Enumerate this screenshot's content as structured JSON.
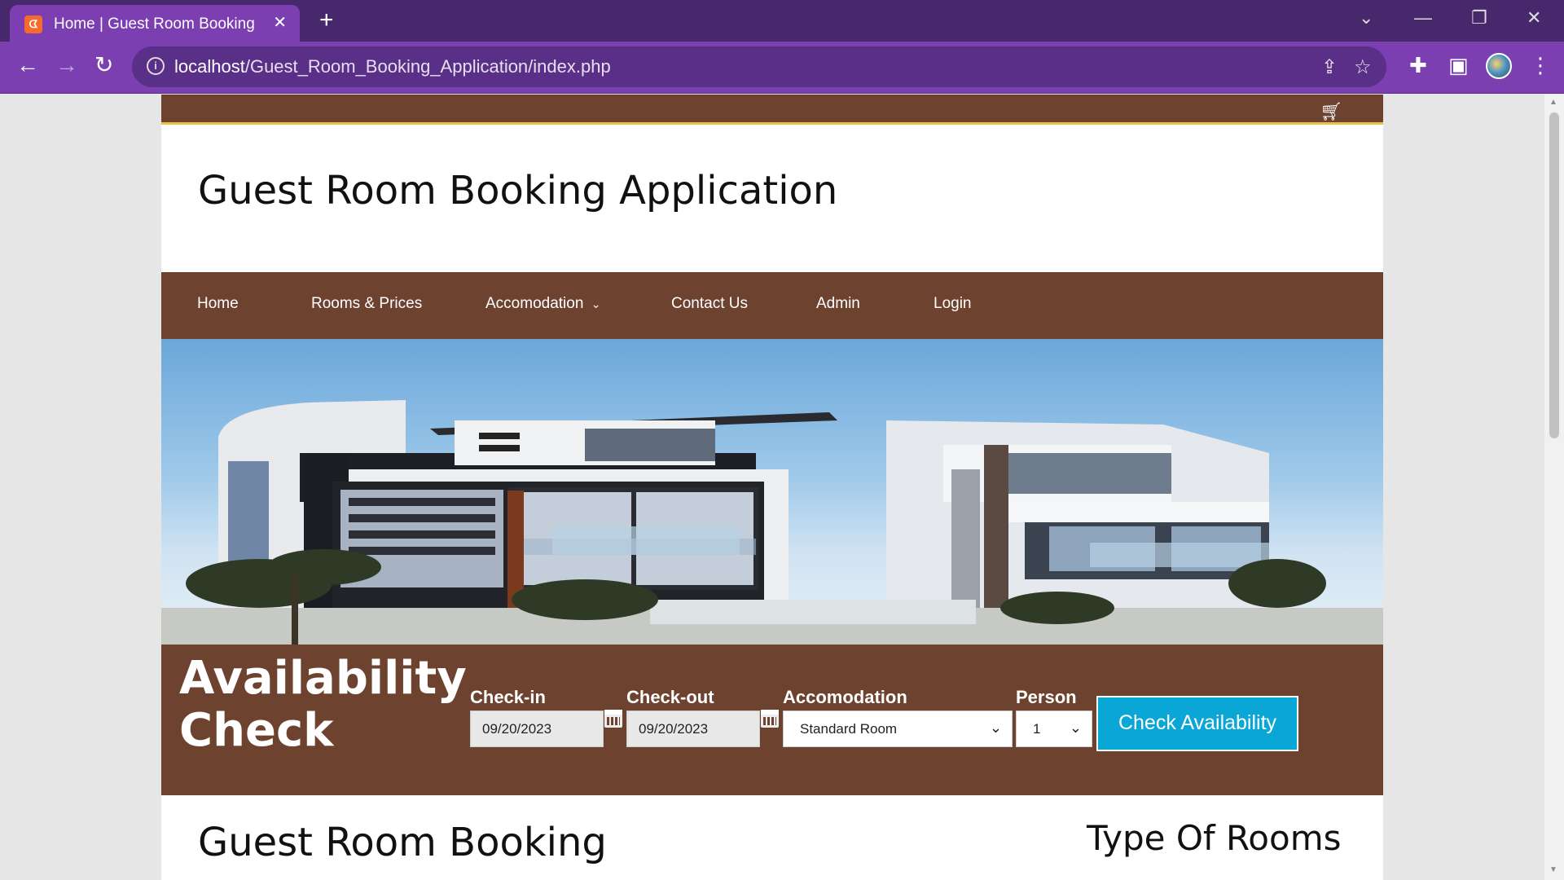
{
  "browser": {
    "tab_title": "Home | Guest Room Booking",
    "tab_favicon": "xampp-icon",
    "url_host": "localhost",
    "url_path": "/Guest_Room_Booking_Application/index.php",
    "accent": "#7b3fb2"
  },
  "site": {
    "title": "Guest Room Booking Application",
    "brand_color": "#6d4330",
    "cart_icon": "shopping-cart-icon"
  },
  "nav": {
    "items": [
      {
        "label": "Home"
      },
      {
        "label": "Rooms & Prices"
      },
      {
        "label": "Accomodation"
      },
      {
        "label": "Contact Us"
      },
      {
        "label": "Admin"
      },
      {
        "label": "Login"
      }
    ]
  },
  "availability": {
    "title_line1": "Availability",
    "title_line2": "Check",
    "checkin_label": "Check-in",
    "checkin_value": "09/20/2023",
    "checkout_label": "Check-out",
    "checkout_value": "09/20/2023",
    "accommodation_label": "Accomodation",
    "accommodation_value": "Standard Room",
    "person_label": "Person",
    "person_value": "1",
    "button_label": "Check Availability",
    "button_color": "#0aa6d6"
  },
  "content": {
    "section_title": "Guest Room Booking",
    "side_title": "Type Of Rooms"
  }
}
